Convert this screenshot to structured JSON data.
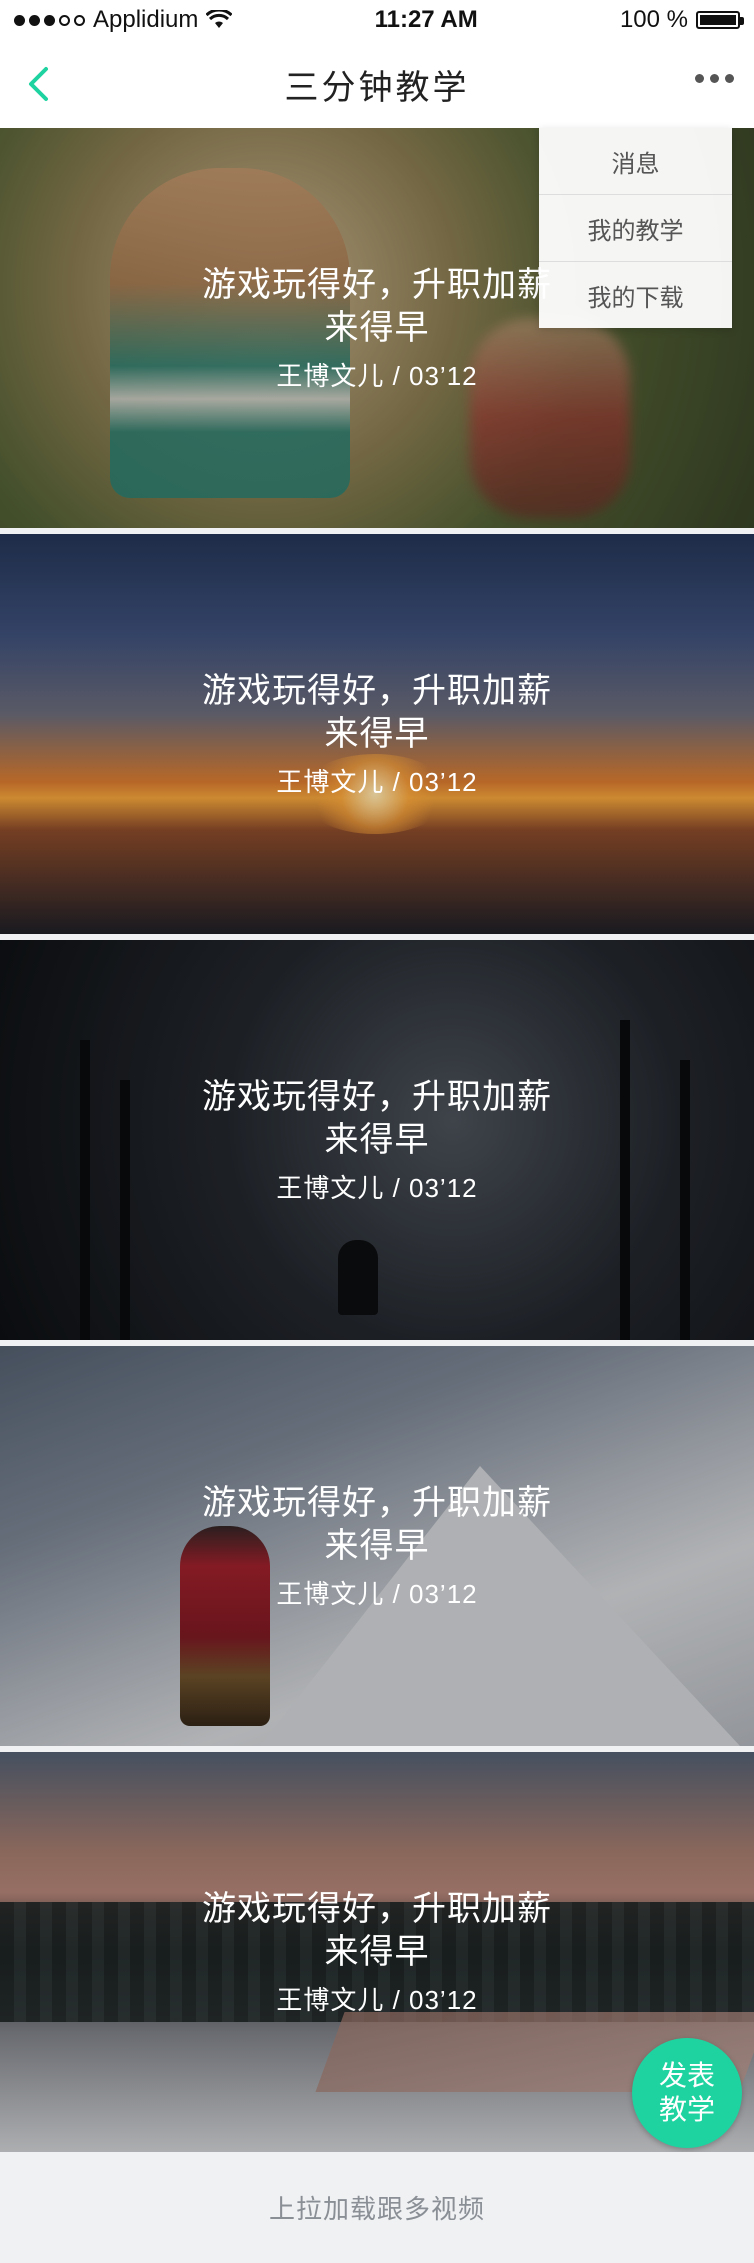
{
  "status_bar": {
    "carrier": "Applidium",
    "time": "11:27 AM",
    "battery_percent": "100 %",
    "signal_dots_filled": 3,
    "signal_dots_total": 5,
    "battery_level": 1.0
  },
  "nav": {
    "title": "三分钟教学",
    "back_icon": "chevron-left-icon",
    "more_icon": "more-horizontal-icon",
    "accent_color": "#1fd3a0"
  },
  "dropdown": {
    "items": [
      {
        "label": "消息"
      },
      {
        "label": "我的教学"
      },
      {
        "label": "我的下载"
      }
    ]
  },
  "cards": [
    {
      "title": "游戏玩得好，升职加薪来得早",
      "author_date": "王博文儿 / 03’12"
    },
    {
      "title": "游戏玩得好，升职加薪来得早",
      "author_date": "王博文儿 / 03’12"
    },
    {
      "title": "游戏玩得好，升职加薪来得早",
      "author_date": "王博文儿 / 03’12"
    },
    {
      "title": "游戏玩得好，升职加薪来得早",
      "author_date": "王博文儿 / 03’12"
    },
    {
      "title": "游戏玩得好，升职加薪来得早",
      "author_date": "王博文儿 / 03’12"
    }
  ],
  "footer": {
    "text": "上拉加载跟多视频"
  },
  "fab": {
    "label": "发表教学"
  }
}
